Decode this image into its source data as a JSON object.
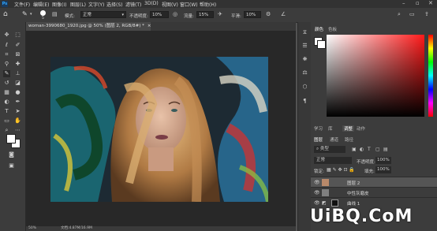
{
  "menu": {
    "items": [
      "文件(F)",
      "编辑(E)",
      "图像(I)",
      "图层(L)",
      "文字(Y)",
      "选择(S)",
      "滤镜(T)",
      "3D(D)",
      "视图(V)",
      "窗口(W)",
      "帮助(H)"
    ]
  },
  "options": {
    "brush_size": "5",
    "mode_label": "模式:",
    "mode_value": "正常",
    "opacity_label": "不透明度:",
    "opacity_value": "10%",
    "flow_label": "流量:",
    "flow_value": "15%",
    "smooth_label": "平滑:",
    "smooth_value": "10%"
  },
  "document": {
    "tab_title": "woman-3990680_1920.jpg @ 50% (图层 2, RGB/8#) *",
    "zoom": "50%",
    "doc_info": "文档:4.87M/16.9M"
  },
  "panels": {
    "color_tabs": [
      "颜色",
      "色板"
    ],
    "adjust_tabs": [
      "学习",
      "库",
      "调整",
      "动作"
    ],
    "layer_tabs": [
      "图层",
      "通道",
      "路径"
    ],
    "kind_label": "类型",
    "blend_mode": "正常",
    "opacity_label": "不透明度:",
    "opacity_value": "100%",
    "lock_label": "锁定:",
    "fill_label": "填充:",
    "fill_value": "100%"
  },
  "layers": [
    {
      "name": "图层 2"
    },
    {
      "name": "中性灰磨皮"
    },
    {
      "name": "曲线 1"
    }
  ],
  "watermark": "UiBQ.CoM",
  "colors": {
    "foreground": "#ffffff",
    "background": "#ffffff"
  }
}
